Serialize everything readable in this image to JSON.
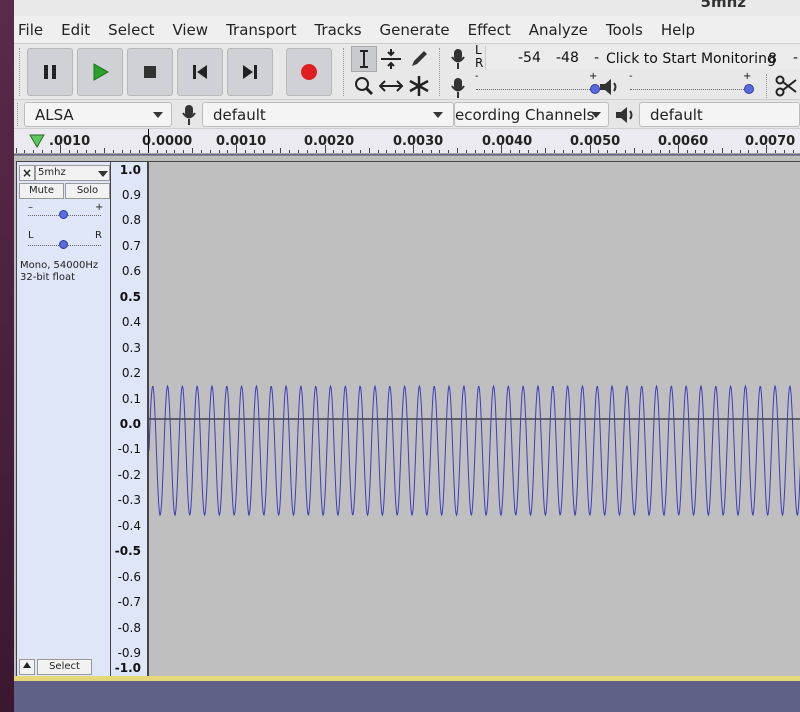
{
  "window": {
    "title_fragment": "5mhz"
  },
  "menu": [
    "File",
    "Edit",
    "Select",
    "View",
    "Transport",
    "Tracks",
    "Generate",
    "Effect",
    "Analyze",
    "Tools",
    "Help"
  ],
  "meter": {
    "lr_top": "L",
    "lr_bottom": "R",
    "scale_54": "-54",
    "scale_48": "-48",
    "dash": "-",
    "monitor_label": "Click to Start Monitoring",
    "cut_suffix": "8",
    "dash2": "-"
  },
  "mixer": {
    "minus": "-",
    "plus": "+"
  },
  "device": {
    "host": "ALSA",
    "recording_device": "default",
    "channels": "ecording Channels",
    "playback_device": "default"
  },
  "ruler": [
    ".0010",
    "0.0000",
    "0.0010",
    "0.0020",
    "0.0030",
    "0.0040",
    "0.0050",
    "0.0060",
    "0.0070"
  ],
  "track": {
    "name": "5mhz",
    "mute": "Mute",
    "solo": "Solo",
    "gain_minus": "–",
    "gain_plus": "+",
    "pan_left": "L",
    "pan_right": "R",
    "info_line1": "Mono, 54000Hz",
    "info_line2": "32-bit float",
    "select": "Select",
    "close": "×"
  },
  "amplitude_scale": [
    "1.0",
    "0.9",
    "0.8",
    "0.7",
    "0.6",
    "0.5",
    "0.4",
    "0.3",
    "0.2",
    "0.1",
    "0.0",
    "-0.1",
    "-0.2",
    "-0.3",
    "-0.4",
    "-0.5",
    "-0.6",
    "-0.7",
    "-0.8",
    "-0.9",
    "-1.0"
  ],
  "waveform": {
    "color": "#3d3dbb",
    "max": 0.13,
    "min": -0.38,
    "cycles_visible": 44
  },
  "colors": {
    "accent": "#5a6ae0",
    "record": "#e02020",
    "play": "#2aa02a"
  }
}
